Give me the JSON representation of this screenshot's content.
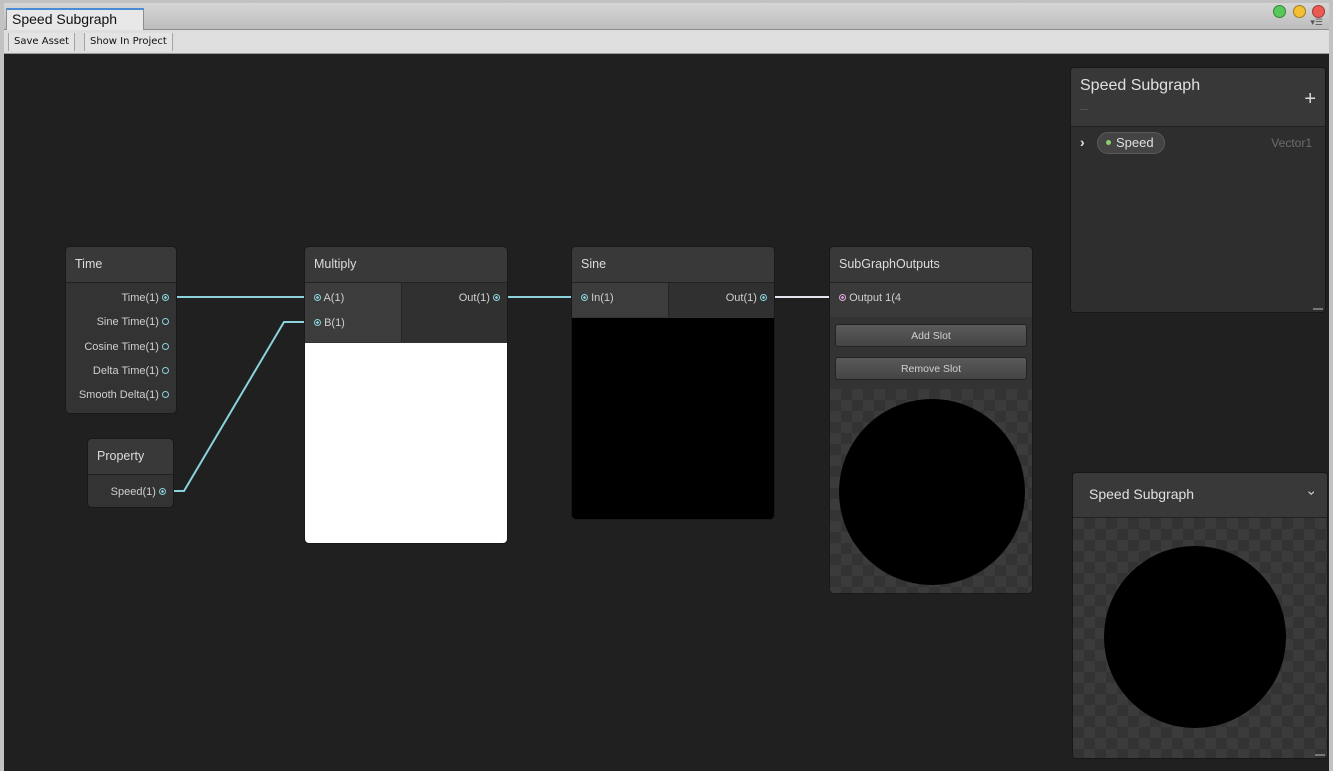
{
  "window": {
    "tab_label": "Speed Subgraph",
    "toolbar": {
      "save_asset": "Save Asset",
      "show_in_project": "Show In Project"
    }
  },
  "nodes": {
    "time": {
      "title": "Time",
      "outputs": [
        "Time(1)",
        "Sine Time(1)",
        "Cosine Time(1)",
        "Delta Time(1)",
        "Smooth Delta(1)"
      ]
    },
    "property": {
      "title": "Property",
      "output": "Speed(1)"
    },
    "multiply": {
      "title": "Multiply",
      "inputs": [
        "A(1)",
        "B(1)"
      ],
      "output": "Out(1)"
    },
    "sine": {
      "title": "Sine",
      "input": "In(1)",
      "output": "Out(1)"
    },
    "subgraph_outputs": {
      "title": "SubGraphOutputs",
      "input": "Output 1(4",
      "add_slot": "Add Slot",
      "remove_slot": "Remove Slot"
    }
  },
  "blackboard": {
    "title": "Speed Subgraph",
    "add_icon": "+",
    "remove_icon": "–",
    "property": {
      "name": "Speed",
      "type": "Vector1"
    }
  },
  "preview": {
    "title": "Speed Subgraph"
  },
  "colors": {
    "canvas": "#202020",
    "wire": "#8ad3dd",
    "vector4_wire": "#e2a8e0",
    "property_dot": "#8ccf6a"
  },
  "icons": [
    "chevron-right-icon",
    "chevron-down-icon",
    "plus-icon",
    "minus-icon",
    "menu-icon",
    "resize-handle-icon"
  ]
}
